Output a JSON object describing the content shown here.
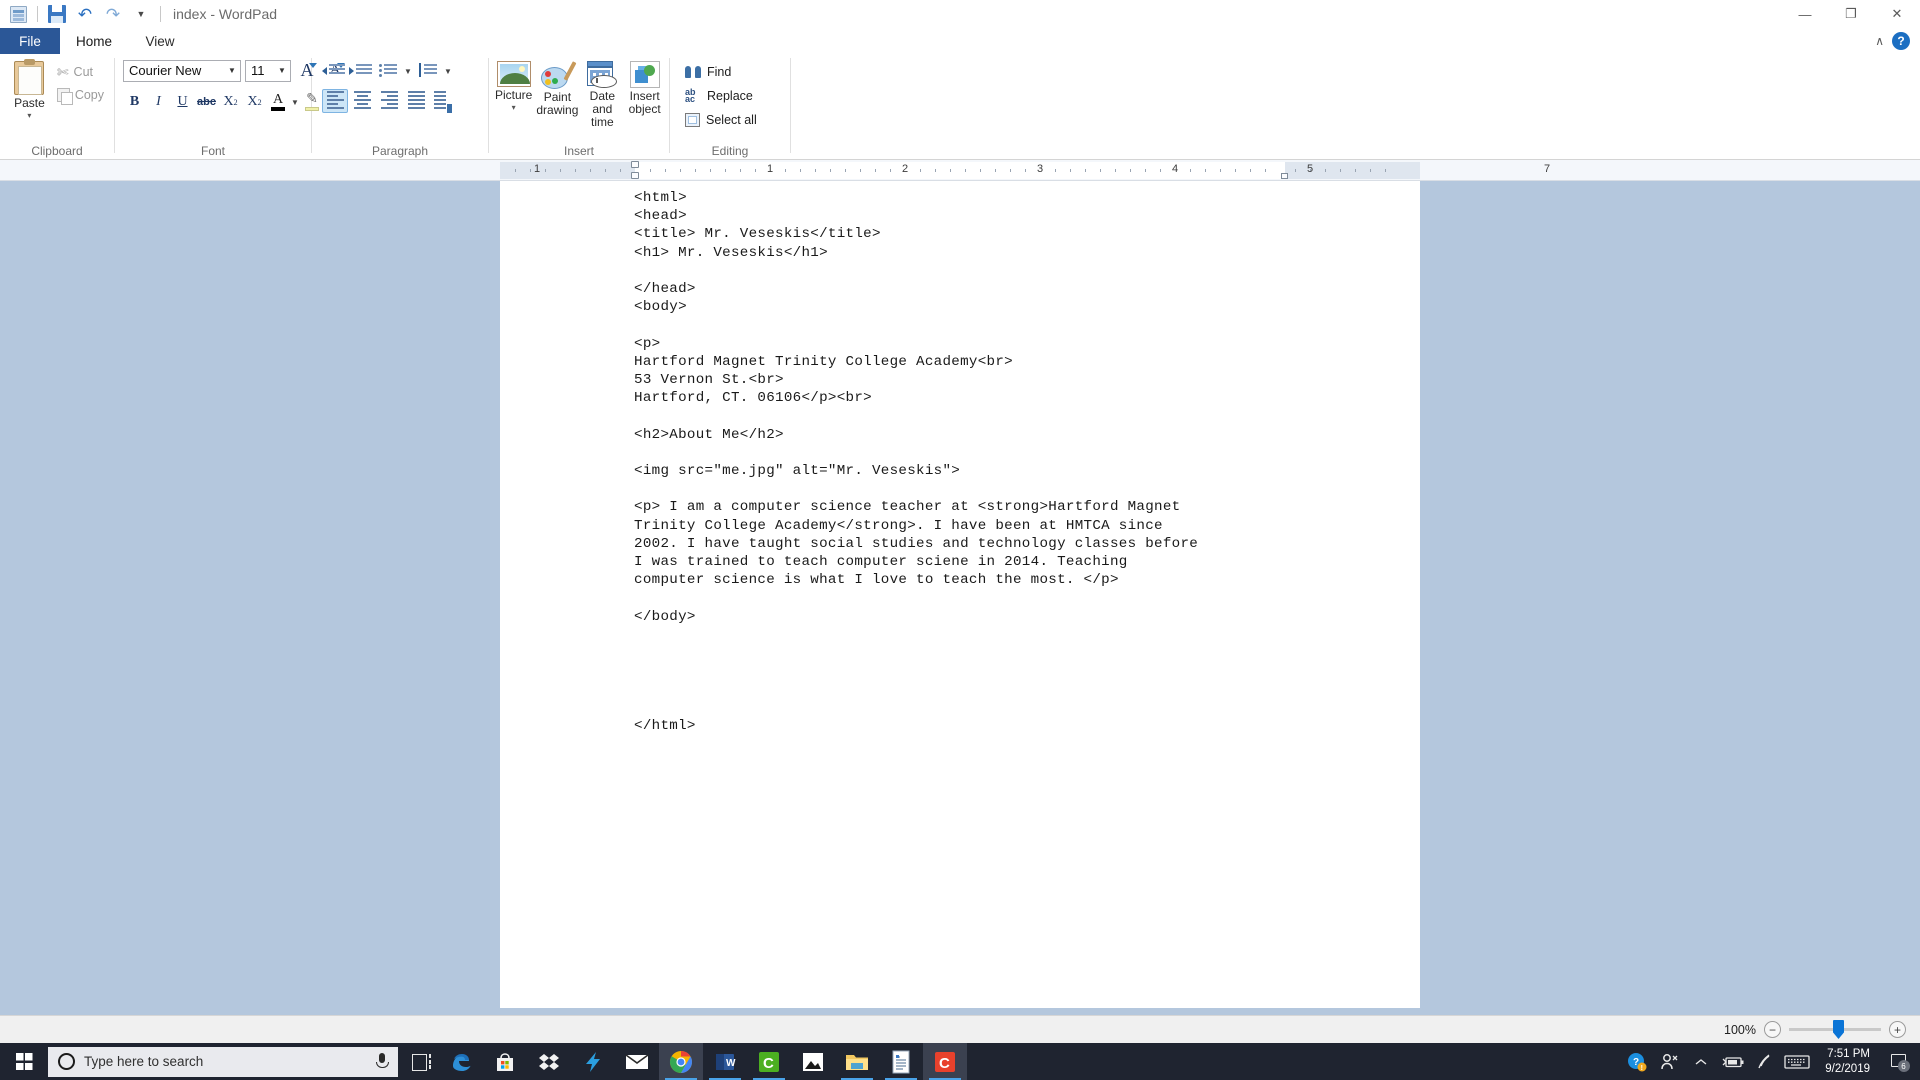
{
  "window": {
    "title": "index - WordPad",
    "quick_access": [
      "app-icon",
      "save-icon",
      "undo-icon",
      "redo-icon",
      "customize-qat-icon"
    ],
    "controls": {
      "minimize": "—",
      "restore": "❐",
      "close": "✕"
    }
  },
  "tabs": [
    {
      "id": "file",
      "label": "File"
    },
    {
      "id": "home",
      "label": "Home"
    },
    {
      "id": "view",
      "label": "View"
    }
  ],
  "tab_right": {
    "collapse": "∧",
    "help": "?"
  },
  "ribbon": {
    "groups": [
      {
        "label": "Clipboard",
        "paste": {
          "label": "Paste",
          "caret": "▾"
        },
        "cut": "Cut",
        "copy": "Copy"
      },
      {
        "label": "Font",
        "font_family": "Courier New",
        "font_size": "11",
        "grow": "A",
        "shrink": "A",
        "bold": "B",
        "italic": "I",
        "underline": "U",
        "strikethrough": "abc",
        "subscript": "X",
        "superscript": "X",
        "text_color": "A",
        "highlight": "✐"
      },
      {
        "label": "Paragraph",
        "decrease_indent": "",
        "increase_indent": "",
        "bullets": "",
        "line_spacing": "",
        "align_left": "",
        "align_center": "",
        "align_right": "",
        "justify": "",
        "paragraph_settings": ""
      },
      {
        "label": "Insert",
        "picture": "Picture",
        "picture_caret": "▾",
        "paint_drawing_line1": "Paint",
        "paint_drawing_line2": "drawing",
        "date_time_line1": "Date and",
        "date_time_line2": "time",
        "insert_object_line1": "Insert",
        "insert_object_line2": "object"
      },
      {
        "label": "Editing",
        "find": "Find",
        "replace": "Replace",
        "select_all": "Select all"
      }
    ]
  },
  "ruler": {
    "numbers": [
      "1",
      "1",
      "2",
      "3",
      "4",
      "5",
      "7"
    ]
  },
  "document": {
    "text": "<html>\n<head>\n<title> Mr. Veseskis</title>\n<h1> Mr. Veseskis</h1>\n\n</head>\n<body>\n\n<p>\nHartford Magnet Trinity College Academy<br>\n53 Vernon St.<br>\nHartford, CT. 06106</p><br>\n\n<h2>About Me</h2>\n\n<img src=\"me.jpg\" alt=\"Mr. Veseskis\">\n\n<p> I am a computer science teacher at <strong>Hartford Magnet\nTrinity College Academy</strong>. I have been at HMTCA since\n2002. I have taught social studies and technology classes before\nI was trained to teach computer sciene in 2014. Teaching\ncomputer science is what I love to teach the most. </p>\n\n</body>\n\n\n\n\n\n</html>"
  },
  "statusbar": {
    "zoom_level": "100%",
    "zoom_out": "−",
    "zoom_in": "+"
  },
  "taskbar": {
    "search_placeholder": "Type here to search",
    "apps": [
      {
        "name": "edge",
        "glyph": "e"
      },
      {
        "name": "microsoft-store",
        "glyph": ""
      },
      {
        "name": "dropbox",
        "glyph": ""
      },
      {
        "name": "lightning-app",
        "glyph": ""
      },
      {
        "name": "mail",
        "glyph": ""
      },
      {
        "name": "chrome",
        "glyph": ""
      },
      {
        "name": "word",
        "glyph": "W"
      },
      {
        "name": "green-c-app",
        "glyph": "C"
      },
      {
        "name": "photos",
        "glyph": ""
      },
      {
        "name": "file-explorer",
        "glyph": ""
      },
      {
        "name": "wordpad",
        "glyph": ""
      },
      {
        "name": "camtasia",
        "glyph": "C"
      }
    ],
    "tray": {
      "time": "7:51 PM",
      "date": "9/2/2019",
      "notification_count": "6"
    }
  },
  "colors": {
    "file_tab": "#2b5797",
    "accent_blue": "#0a74d6",
    "desktop": "#b4c7dd",
    "taskbar": "#1f2430"
  }
}
